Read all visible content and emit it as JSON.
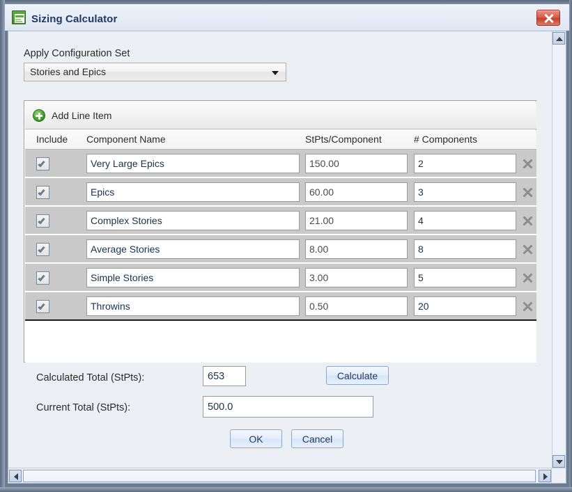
{
  "window": {
    "title": "Sizing Calculator",
    "icon": "document-form-icon",
    "close_label": "X"
  },
  "config": {
    "label": "Apply Configuration Set",
    "selected": "Stories and Epics",
    "arrow_icon": "chevron-down-icon"
  },
  "grid": {
    "add_line_item_label": "Add Line Item",
    "add_icon": "plus-circle-icon",
    "delete_icon": "close-x-icon",
    "columns": [
      "Include",
      "Component Name",
      "StPts/Component",
      "# Components"
    ],
    "rows": [
      {
        "include": true,
        "name": "Very Large Epics",
        "stpts": "150.00",
        "count": "2"
      },
      {
        "include": true,
        "name": "Epics",
        "stpts": "60.00",
        "count": "3"
      },
      {
        "include": true,
        "name": "Complex Stories",
        "stpts": "21.00",
        "count": "4"
      },
      {
        "include": true,
        "name": "Average Stories",
        "stpts": "8.00",
        "count": "8"
      },
      {
        "include": true,
        "name": "Simple Stories",
        "stpts": "3.00",
        "count": "5"
      },
      {
        "include": true,
        "name": "Throwins",
        "stpts": "0.50",
        "count": "20"
      }
    ]
  },
  "totals": {
    "calculated_label": "Calculated Total (StPts):",
    "calculated_value": "653",
    "calculate_button": "Calculate",
    "current_label": "Current Total (StPts):",
    "current_value": "500.0"
  },
  "actions": {
    "ok": "OK",
    "cancel": "Cancel"
  },
  "scrollbars": {
    "up_icon": "triangle-up-icon",
    "down_icon": "triangle-down-icon",
    "left_icon": "triangle-left-icon",
    "right_icon": "triangle-right-icon"
  },
  "colors": {
    "accent": "#1f3864",
    "close_red": "#c0412e",
    "add_green": "#49a033",
    "row_gray": "#c9c9c9"
  }
}
